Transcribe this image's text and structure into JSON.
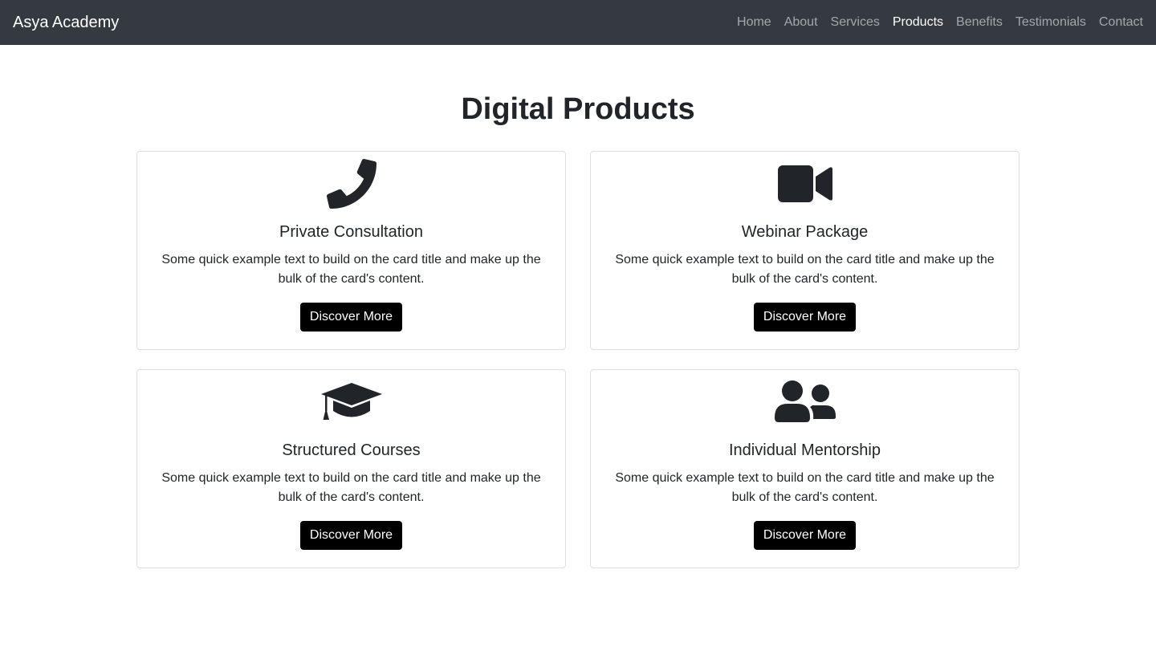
{
  "navbar": {
    "brand": "Asya Academy",
    "links": [
      {
        "label": "Home",
        "active": false
      },
      {
        "label": "About",
        "active": false
      },
      {
        "label": "Services",
        "active": false
      },
      {
        "label": "Products",
        "active": true
      },
      {
        "label": "Benefits",
        "active": false
      },
      {
        "label": "Testimonials",
        "active": false
      },
      {
        "label": "Contact",
        "active": false
      }
    ]
  },
  "products": {
    "heading": "Digital Products",
    "cards": [
      {
        "icon": "phone-icon",
        "title": "Private Consultation",
        "text": "Some quick example text to build on the card title and make up the bulk of the card's content.",
        "button": "Discover More"
      },
      {
        "icon": "video-camera-icon",
        "title": "Webinar Package",
        "text": "Some quick example text to build on the card title and make up the bulk of the card's content.",
        "button": "Discover More"
      },
      {
        "icon": "graduation-cap-icon",
        "title": "Structured Courses",
        "text": "Some quick example text to build on the card title and make up the bulk of the card's content.",
        "button": "Discover More"
      },
      {
        "icon": "user-group-icon",
        "title": "Individual Mentorship",
        "text": "Some quick example text to build on the card title and make up the bulk of the card's content.",
        "button": "Discover More"
      }
    ]
  },
  "colors": {
    "navbar_bg": "#343a40",
    "text": "#212529",
    "button_bg": "#000000",
    "nav_active": "#ffffff",
    "nav_inactive": "rgba(255,255,255,0.55)"
  }
}
